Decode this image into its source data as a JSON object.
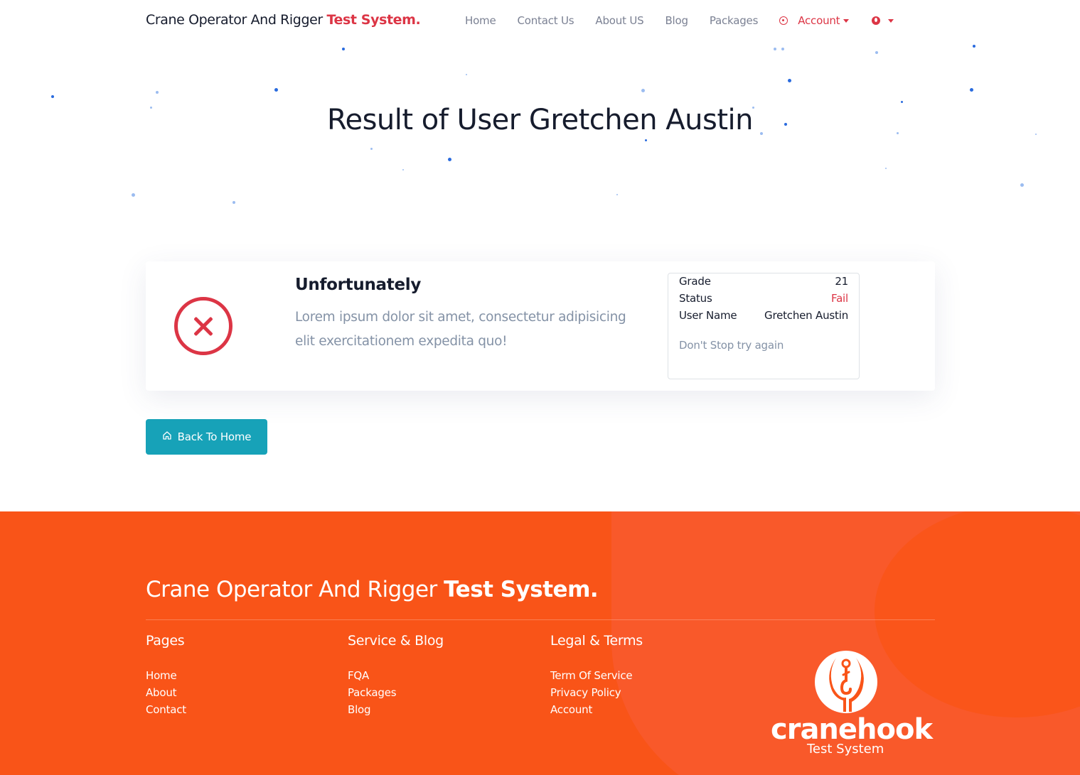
{
  "nav": {
    "brand_regular": "Crane Operator And Rigger ",
    "brand_bold": "Test System.",
    "items": [
      "Home",
      "Contact Us",
      "About US",
      "Blog",
      "Packages"
    ],
    "account_label": "Account"
  },
  "hero": {
    "title": "Result of User Gretchen Austin"
  },
  "result": {
    "heading": "Unfortunately",
    "text": "Lorem ipsum dolor sit amet, consectetur adipisicing elit exercitationem expedita quo!",
    "grade_label": "Grade",
    "grade_value": "21",
    "status_label": "Status",
    "status_value": "Fail",
    "username_label": "User Name",
    "username_value": "Gretchen Austin",
    "note": "Don't Stop try again",
    "status_color": "#dc3545"
  },
  "back_button": {
    "label": "Back To Home",
    "color": "#17a2b8"
  },
  "footer": {
    "brand_regular": "Crane Operator And Rigger ",
    "brand_bold": "Test System.",
    "background": "#f95418",
    "columns": [
      {
        "title": "Pages",
        "links": [
          "Home",
          "About",
          "Contact"
        ]
      },
      {
        "title": "Service & Blog",
        "links": [
          "FQA",
          "Packages",
          "Blog"
        ]
      },
      {
        "title": "Legal & Terms",
        "links": [
          "Term Of Service",
          "Privacy Policy",
          "Account"
        ]
      }
    ],
    "logo_word": "cranehook",
    "logo_sub": "Test System"
  }
}
